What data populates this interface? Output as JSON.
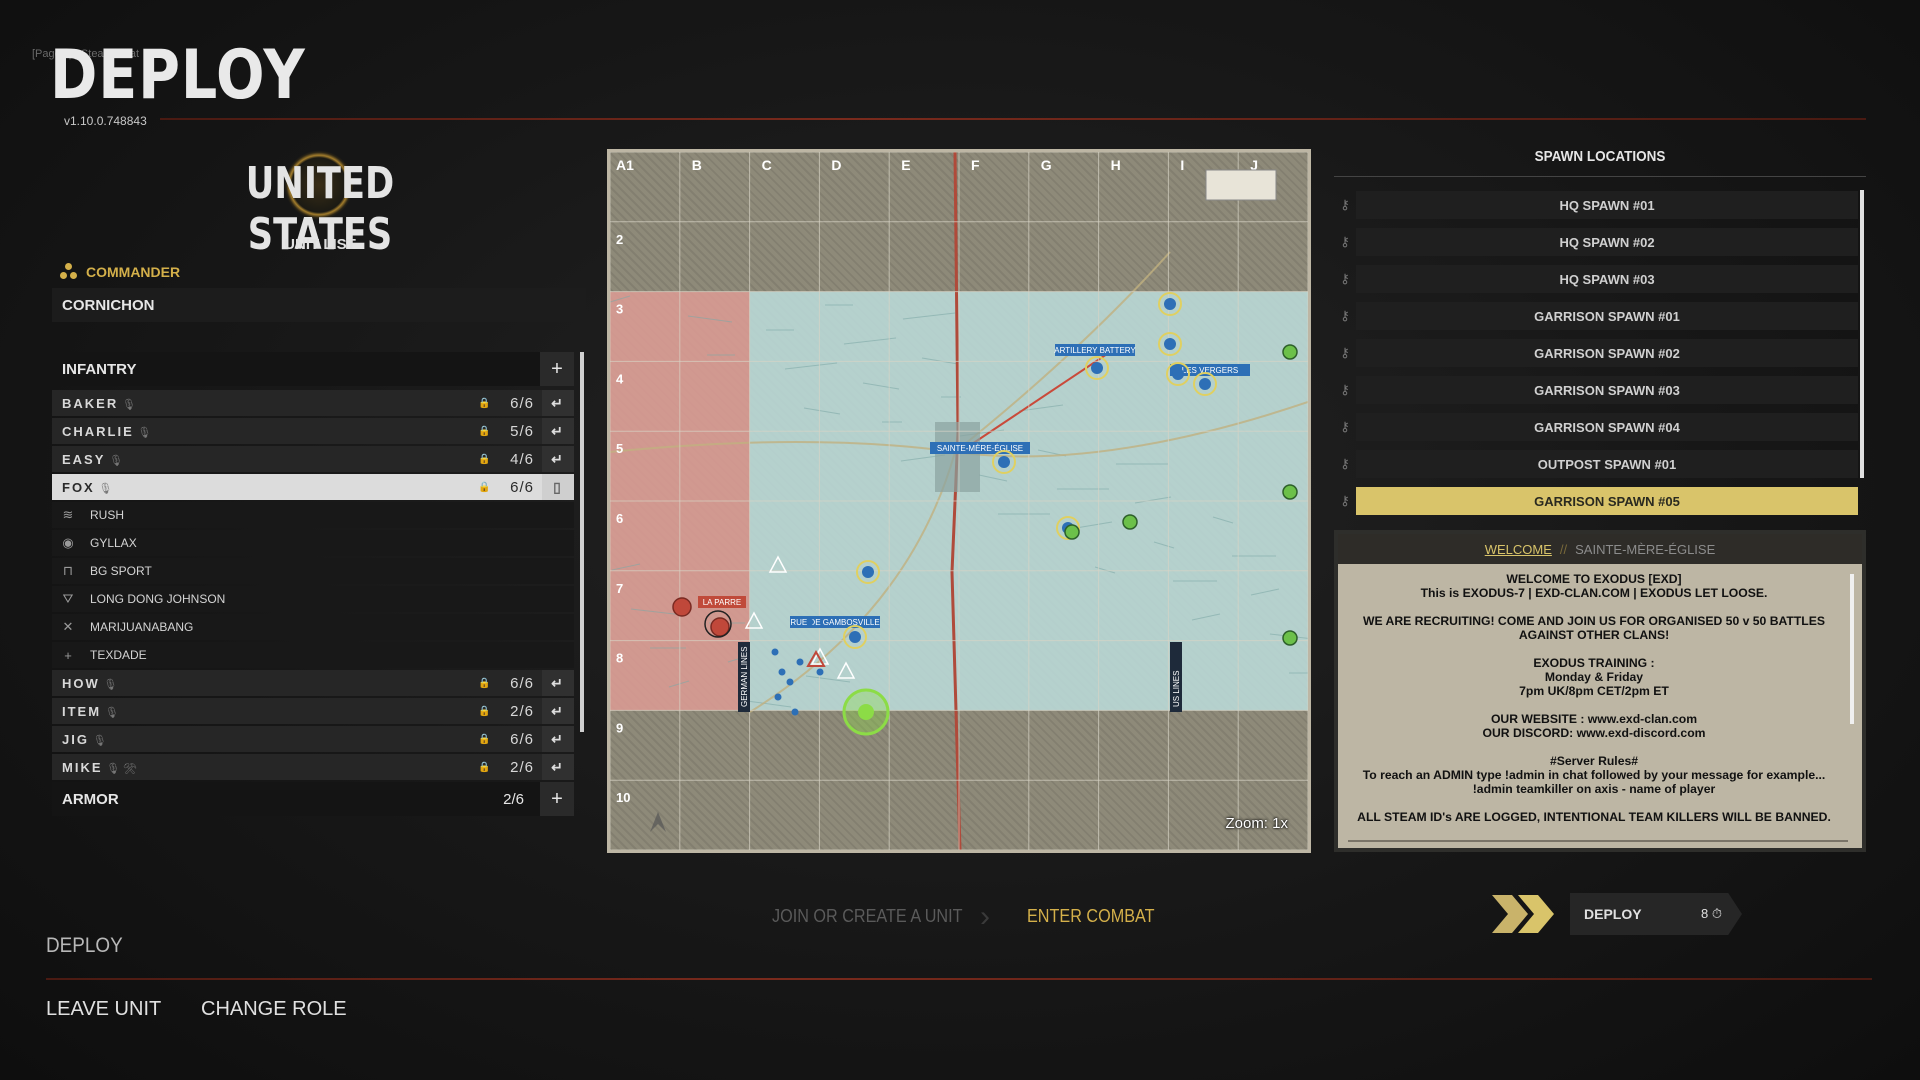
{
  "header": {
    "page_hint": "[PageUp] Steam Chat",
    "title": "DEPLOY",
    "version": "v1.10.0.748843"
  },
  "faction": {
    "name": "UNITED STATES",
    "unit_list_label": "UNIT LIST"
  },
  "commander": {
    "label": "COMMANDER",
    "player": "CORNICHON"
  },
  "infantry": {
    "label": "INFANTRY",
    "add": "+",
    "squads_top": [
      {
        "name": "BAKER",
        "count": "6/6",
        "action": "↵"
      },
      {
        "name": "CHARLIE",
        "count": "5/6",
        "action": "↵"
      },
      {
        "name": "EASY",
        "count": "4/6",
        "action": "↵"
      },
      {
        "name": "FOX",
        "count": "6/6",
        "action": "▯"
      }
    ],
    "fox_members": [
      {
        "name": "RUSH",
        "icon": "chevron-rank-icon"
      },
      {
        "name": "GYLLAX",
        "icon": "target-icon"
      },
      {
        "name": "BG SPORT",
        "icon": "support-icon"
      },
      {
        "name": "LONG DONG JOHNSON",
        "icon": "officer-icon"
      },
      {
        "name": "MARIJUANABANG",
        "icon": "crossed-swords-icon"
      },
      {
        "name": "TEXDADE",
        "icon": "medic-cross-icon"
      }
    ],
    "squads_bottom": [
      {
        "name": "HOW",
        "count": "6/6",
        "action": "↵"
      },
      {
        "name": "ITEM",
        "count": "2/6",
        "action": "↵"
      },
      {
        "name": "JIG",
        "count": "6/6",
        "action": "↵"
      },
      {
        "name": "MIKE",
        "count": "2/6",
        "action": "↵"
      }
    ]
  },
  "armor": {
    "label": "ARMOR",
    "count": "2/6",
    "add": "+"
  },
  "map": {
    "cols": [
      "A",
      "B",
      "C",
      "D",
      "E",
      "F",
      "G",
      "H",
      "I",
      "J"
    ],
    "rows": [
      "1",
      "2",
      "3",
      "4",
      "5",
      "6",
      "7",
      "8",
      "9",
      "10"
    ],
    "labels": {
      "town": "SAINTE-MÈRE-ÉGLISE",
      "battery": "ARTILLERY BATTERY",
      "vergers": "LES VERGERS",
      "church": "RUE DE GAMBOSVILLE",
      "farm": "LA PARRE",
      "german_lines": "GERMAN LINES",
      "us_lines": "US LINES"
    },
    "zoom": "Zoom: 1x",
    "colors": {
      "axis_zone": "#d89a92",
      "allied_zone": "#b9d8d6",
      "neutral": "#8e8a79"
    }
  },
  "spawns": {
    "title": "SPAWN LOCATIONS",
    "items": [
      {
        "label": "HQ SPAWN #01",
        "active": false
      },
      {
        "label": "HQ SPAWN #02",
        "active": false
      },
      {
        "label": "HQ SPAWN #03",
        "active": false
      },
      {
        "label": "GARRISON SPAWN #01",
        "active": false
      },
      {
        "label": "GARRISON SPAWN #02",
        "active": false
      },
      {
        "label": "GARRISON SPAWN #03",
        "active": false
      },
      {
        "label": "GARRISON SPAWN #04",
        "active": false
      },
      {
        "label": "OUTPOST SPAWN #01",
        "active": false
      },
      {
        "label": "GARRISON SPAWN #05",
        "active": true
      }
    ]
  },
  "welcome": {
    "tab_active": "WELCOME",
    "separator": "//",
    "tab_map": "SAINTE-MÈRE-ÉGLISE",
    "text": "WELCOME TO EXODUS [EXD]\nThis is  EXODUS-7 | EXD-CLAN.COM | EXODUS LET LOOSE.\n\nWE ARE RECRUITING! COME AND JOIN US FOR ORGANISED 50 v 50 BATTLES\nAGAINST OTHER CLANS!\n\nEXODUS TRAINING :\nMonday & Friday\n7pm UK/8pm CET/2pm ET\n\nOUR WEBSITE :  www.exd-clan.com\nOUR DISCORD: www.exd-discord.com\n\n#Server Rules#\nTo reach an ADMIN type !admin in chat followed by your message for example...\n!admin teamkiller on axis - name of player\n\nALL STEAM ID's ARE LOGGED, INTENTIONAL TEAM KILLERS WILL BE BANNED."
  },
  "steps": {
    "step1": "JOIN OR CREATE A UNIT",
    "arrow": "›",
    "step2": "ENTER COMBAT"
  },
  "deploy_button": {
    "label": "DEPLOY",
    "timer": "8 ⏱"
  },
  "footer": {
    "section": "DEPLOY",
    "leave": "LEAVE UNIT",
    "role": "CHANGE ROLE"
  },
  "accent_color": "#d4b04a"
}
